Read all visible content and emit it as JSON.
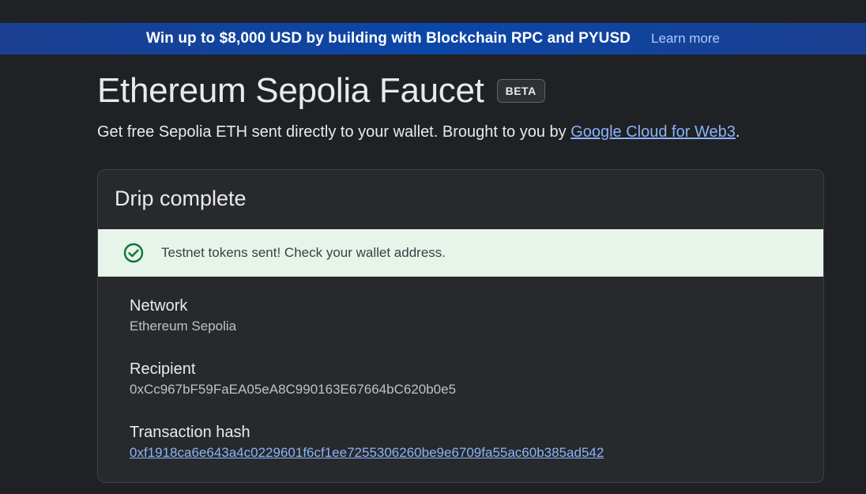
{
  "banner": {
    "text": "Win up to $8,000 USD by building with Blockchain RPC and PYUSD",
    "link_label": "Learn more"
  },
  "header": {
    "title": "Ethereum Sepolia Faucet",
    "badge": "BETA",
    "subtitle_prefix": "Get free Sepolia ETH sent directly to your wallet. Brought to you by ",
    "subtitle_link": "Google Cloud for Web3",
    "subtitle_suffix": "."
  },
  "card": {
    "title": "Drip complete",
    "alert": {
      "icon": "check-circle-icon",
      "message": "Testnet tokens sent! Check your wallet address."
    },
    "fields": {
      "network": {
        "label": "Network",
        "value": "Ethereum Sepolia"
      },
      "recipient": {
        "label": "Recipient",
        "value": "0xCc967bF59FaEA05eA8C990163E67664bC620b0e5"
      },
      "transaction": {
        "label": "Transaction hash",
        "value": "0xf1918ca6e643a4c0229601f6cf1ee7255306260be9e6709fa55ac60b385ad542"
      }
    }
  },
  "colors": {
    "background": "#202124",
    "banner": "#0b47a8",
    "link": "#8ab4f8",
    "success_bg": "#e6f4ea",
    "success_icon": "#137333"
  }
}
